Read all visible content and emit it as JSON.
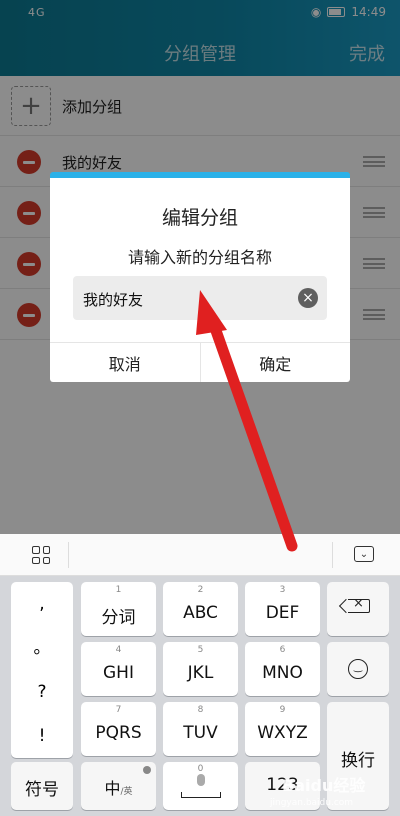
{
  "status_bar": {
    "signal": "4G",
    "time": "14:49"
  },
  "header": {
    "title": "分组管理",
    "done_label": "完成"
  },
  "list": {
    "add_label": "添加分组",
    "add_icon": "plus-icon",
    "groups": [
      {
        "name": "我的好友"
      },
      {
        "name": ""
      },
      {
        "name": ""
      },
      {
        "name": ""
      }
    ]
  },
  "dialog": {
    "title": "编辑分组",
    "prompt": "请输入新的分组名称",
    "input_value": "我的好友",
    "cancel_label": "取消",
    "confirm_label": "确定",
    "accent_color": "#2bb1e8"
  },
  "annotation": {
    "arrow_color": "#e02020"
  },
  "keyboard": {
    "punct": [
      ",",
      "。",
      "?",
      "!"
    ],
    "rows": [
      [
        {
          "hint": "1",
          "label": "分词"
        },
        {
          "hint": "2",
          "label": "ABC"
        },
        {
          "hint": "3",
          "label": "DEF"
        }
      ],
      [
        {
          "hint": "4",
          "label": "GHI"
        },
        {
          "hint": "5",
          "label": "JKL"
        },
        {
          "hint": "6",
          "label": "MNO"
        }
      ],
      [
        {
          "hint": "7",
          "label": "PQRS"
        },
        {
          "hint": "8",
          "label": "TUV"
        },
        {
          "hint": "9",
          "label": "WXYZ"
        }
      ]
    ],
    "symbols_label": "符号",
    "lang_label": "中",
    "lang_sub": "/英",
    "space_hint": "0",
    "num_label": "123",
    "enter_label": "换行"
  },
  "watermark": {
    "brand": "Baidu经验",
    "site": "jingyan.baidu.com"
  }
}
